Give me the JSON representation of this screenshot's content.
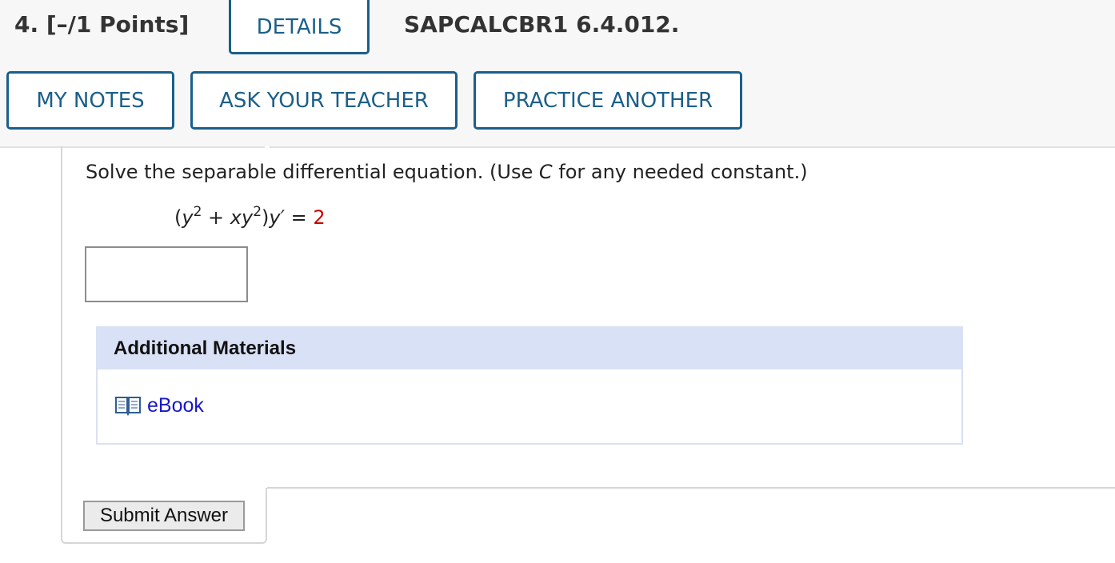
{
  "question": {
    "number_label": "4.",
    "points_label": "[–/1 Points]",
    "details_label": "DETAILS",
    "problem_id": "SAPCALCBR1 6.4.012."
  },
  "actions": {
    "notes_label": "MY NOTES",
    "teacher_label": "ASK YOUR TEACHER",
    "practice_label": "PRACTICE ANOTHER"
  },
  "problem": {
    "prompt_before": "Solve the separable differential equation. (Use ",
    "prompt_var": "C",
    "prompt_after": " for any needed constant.)",
    "eq_open": "(",
    "eq_y1": "y",
    "eq_exp1": "2",
    "eq_plus": " + ",
    "eq_xy": "xy",
    "eq_exp2": "2",
    "eq_close": ")",
    "eq_yprime": "y′",
    "eq_equals": " = ",
    "eq_rhs": "2",
    "answer_value": ""
  },
  "materials": {
    "heading": "Additional Materials",
    "ebook_label": "eBook",
    "ebook_icon": "book-icon"
  },
  "submit": {
    "label": "Submit Answer"
  },
  "colors": {
    "accent": "#1b5f8a",
    "materials_header": "#d9e1f6",
    "link": "#1717cc",
    "highlight": "#cc0000"
  }
}
